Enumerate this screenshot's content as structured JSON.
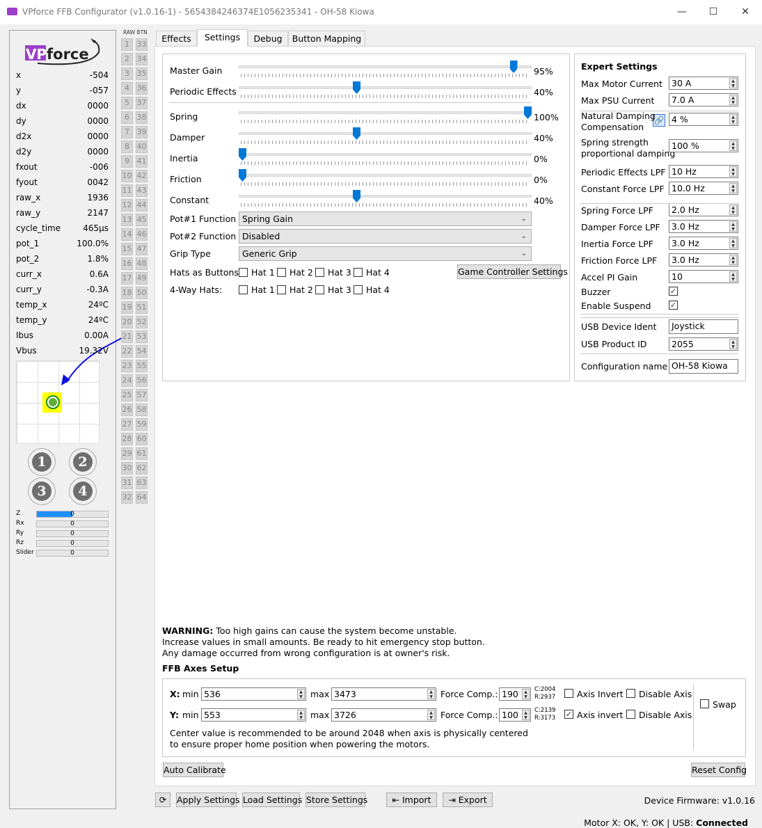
{
  "window": {
    "title": "VPforce FFB Configurator (v1.0.16-1) - 5654384246374E1056235341 - OH-58 Kiowa",
    "logo_text": "VPforce"
  },
  "stats": [
    {
      "label": "x",
      "value": "-504"
    },
    {
      "label": "y",
      "value": "-057"
    },
    {
      "label": "dx",
      "value": "0000"
    },
    {
      "label": "dy",
      "value": "0000"
    },
    {
      "label": "d2x",
      "value": "0000"
    },
    {
      "label": "d2y",
      "value": "0000"
    },
    {
      "label": "fxout",
      "value": "-006"
    },
    {
      "label": "fyout",
      "value": "0042"
    },
    {
      "label": "raw_x",
      "value": "1936"
    },
    {
      "label": "raw_y",
      "value": "2147"
    },
    {
      "label": "cycle_time",
      "value": "465µs"
    },
    {
      "label": "pot_1",
      "value": "100.0%"
    },
    {
      "label": "pot_2",
      "value": "1.8%"
    },
    {
      "label": "curr_x",
      "value": "0.6A"
    },
    {
      "label": "curr_y",
      "value": "-0.3A"
    },
    {
      "label": "temp_x",
      "value": "24ºC"
    },
    {
      "label": "temp_y",
      "value": "24ºC"
    },
    {
      "label": "Ibus",
      "value": "0.00A"
    },
    {
      "label": "Vbus",
      "value": "19.32V"
    }
  ],
  "hat_buttons": [
    "1",
    "2",
    "3",
    "4"
  ],
  "axes": [
    {
      "label": "Z",
      "value": "0",
      "fill": 0.5
    },
    {
      "label": "Rx",
      "value": "0",
      "fill": 0
    },
    {
      "label": "Ry",
      "value": "0",
      "fill": 0
    },
    {
      "label": "Rz",
      "value": "0",
      "fill": 0
    },
    {
      "label": "Slider",
      "value": "0",
      "fill": 0
    }
  ],
  "raw_btn_header": "RAW BTN",
  "tabs": [
    {
      "label": "Effects"
    },
    {
      "label": "Settings",
      "active": true
    },
    {
      "label": "Debug"
    },
    {
      "label": "Button Mapping"
    }
  ],
  "sliders": [
    {
      "label": "Master Gain",
      "value": 95,
      "text": "95%"
    },
    {
      "label": "Periodic Effects",
      "value": 40,
      "text": "40%"
    },
    {
      "label": "Spring",
      "value": 100,
      "text": "100%"
    },
    {
      "label": "Damper",
      "value": 40,
      "text": "40%"
    },
    {
      "label": "Inertia",
      "value": 0,
      "text": "0%"
    },
    {
      "label": "Friction",
      "value": 0,
      "text": "0%"
    },
    {
      "label": "Constant",
      "value": 40,
      "text": "40%"
    }
  ],
  "combos": [
    {
      "label": "Pot#1 Function",
      "value": "Spring Gain"
    },
    {
      "label": "Pot#2 Function",
      "value": "Disabled"
    },
    {
      "label": "Grip Type",
      "value": "Generic Grip"
    }
  ],
  "hats": {
    "buttons_label": "Hats as Buttons:",
    "fourway_label": "4-Way Hats:",
    "items": [
      "Hat 1",
      "Hat 2",
      "Hat 3",
      "Hat 4"
    ],
    "game_controller_button": "Game Controller Settings"
  },
  "expert": {
    "title": "Expert Settings",
    "fields": [
      {
        "label": "Max Motor Current",
        "value": "30 A"
      },
      {
        "label": "Max PSU Current",
        "value": "7.0 A"
      },
      {
        "label": "Natural Damping\nCompensation",
        "value": "4 %"
      },
      {
        "label": "Spring strength\nproportional damping",
        "value": "100 %"
      },
      {
        "label": "Periodic Effects LPF",
        "value": "10 Hz"
      },
      {
        "label": "Constant Force LPF",
        "value": "10.0 Hz"
      },
      {
        "label": "Spring Force LPF",
        "value": "2.0 Hz"
      },
      {
        "label": "Damper Force LPF",
        "value": "3.0 Hz"
      },
      {
        "label": "Inertia Force LPF",
        "value": "3.0 Hz"
      },
      {
        "label": "Friction Force LPF",
        "value": "3.0 Hz"
      },
      {
        "label": "Accel PI Gain",
        "value": "10"
      }
    ],
    "buzzer": {
      "label": "Buzzer",
      "checked": true
    },
    "suspend": {
      "label": "Enable Suspend",
      "checked": true
    },
    "usb_ident": {
      "label": "USB Device Ident",
      "value": "Joystick"
    },
    "usb_pid": {
      "label": "USB Product ID",
      "value": "2055"
    },
    "config_name": {
      "label": "Configuration name",
      "value": "OH-58 Kiowa"
    }
  },
  "warning": {
    "bold": "WARNING:",
    "line1": " Too high gains can cause the system become unstable.",
    "line2": "Increase values in small amounts. Be ready to hit emergency stop button.",
    "line3": "Any damage occurred from wrong configuration is at owner's risk."
  },
  "ffb_axes": {
    "title": "FFB Axes Setup",
    "x": {
      "label": "X:",
      "min_label": "min",
      "min": "536",
      "max_label": "max",
      "max": "3473",
      "fc_label": "Force Comp.:",
      "fc": "190",
      "c": "C:2004",
      "r": "R:2937",
      "invert_label": "Axis Invert",
      "invert": false,
      "disable_label": "Disable Axis",
      "disable": false
    },
    "y": {
      "label": "Y:",
      "min_label": "min",
      "min": "553",
      "max_label": "max",
      "max": "3726",
      "fc_label": "Force Comp.:",
      "fc": "100",
      "c": "C:2139",
      "r": "R:3173",
      "invert_label": "Axis invert",
      "invert": true,
      "disable_label": "Disable Axis",
      "disable": false
    },
    "swap_label": "Swap",
    "swap": false,
    "note1": "Center value is recommended to be around 2048 when axis is physically centered",
    "note2": "to ensure proper home position when powering the motors."
  },
  "buttons": {
    "auto_calibrate": "Auto Calibrate",
    "reset_config": "Reset Config",
    "apply": "Apply Settings",
    "load": "Load Settings",
    "store": "Store Settings",
    "import": "Import",
    "export": "Export"
  },
  "status": {
    "firmware": "Device Firmware:  v1.0.16",
    "motor": "Motor X: OK, Y: OK | USB: ",
    "usb": "Connected"
  },
  "colors": {
    "accent": "#0078d7",
    "logo": "#9b3fc9"
  }
}
